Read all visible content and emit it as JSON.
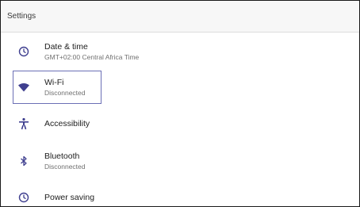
{
  "app": {
    "title": "Settings"
  },
  "colors": {
    "icon": "#3f3f8f",
    "focus_border": "#6b6fb5",
    "toolbar_bg": "#f7f7f7"
  },
  "items": [
    {
      "label": "Date & time",
      "summary": "GMT+02:00 Central Africa Time",
      "icon": "clock-icon"
    },
    {
      "label": "Wi-Fi",
      "summary": "Disconnected",
      "icon": "wifi-icon",
      "focused": true
    },
    {
      "label": "Accessibility",
      "summary": "",
      "icon": "accessibility-icon"
    },
    {
      "label": "Bluetooth",
      "summary": "Disconnected",
      "icon": "bluetooth-icon"
    },
    {
      "label": "Power saving",
      "summary": "",
      "icon": "clock-icon"
    }
  ]
}
